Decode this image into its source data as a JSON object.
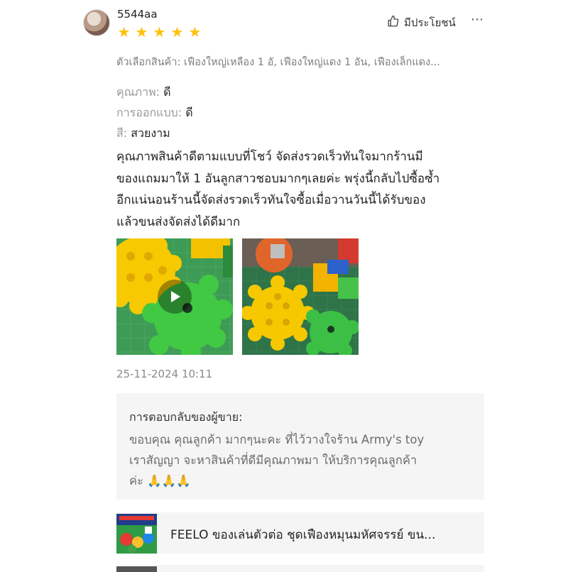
{
  "review": {
    "username": "5544aa",
    "rating": 5,
    "helpful_label": "มีประโยชน์",
    "variation_label": "ตัวเลือกสินค้า:",
    "variation_value": "เฟืองใหญ่เหลือง 1 อั, เฟืองใหญ่แดง 1 อัน, เฟืองเล็กแดง...",
    "attributes": [
      {
        "key": "คุณภาพ:",
        "value": "ดี"
      },
      {
        "key": "การออกแบบ:",
        "value": "ดี"
      },
      {
        "key": "สี:",
        "value": "สวยงาม"
      }
    ],
    "comment_lines": [
      "คุณภาพสินค้าดีตามแบบที่โชว์ จัดส่งรวดเร็วทันใจมากร้านมี",
      "ของแถมมาให้ 1 อันลูกสาวชอบมากๆเลยค่ะ พรุ่งนี้กลับไปซื้อซ้ำ",
      "อีกแน่นอนร้านนี้จัดส่งรวดเร็วทันใจซื้อเมื่อวานวันนี้ได้รับของ",
      "แล้วขนส่งจัดส่งได้ดีมาก"
    ],
    "media": [
      {
        "kind": "video",
        "icon": "play-icon"
      },
      {
        "kind": "photo"
      }
    ],
    "datetime": "25-11-2024 10:11"
  },
  "seller_reply": {
    "title": "การตอบกลับของผู้ขาย:",
    "lines": [
      "ขอบคุณ คุณลูกค้า มากๆนะคะ ที่ไว้วางใจร้าน Army's toy",
      "เราสัญญา จะหาสินค้าที่ดีมีคุณภาพมา ให้บริการคุณลูกค้า",
      "ค่ะ 🙏🙏🙏"
    ]
  },
  "product": {
    "name": "FEELO ของเล่นตัวต่อ ชุดเฟืองหมุนมหัศจรรย์ ขน..."
  },
  "colors": {
    "star": "#ffc107",
    "reply_bg": "#f5f5f5",
    "muted_text": "#8a8a8a"
  }
}
